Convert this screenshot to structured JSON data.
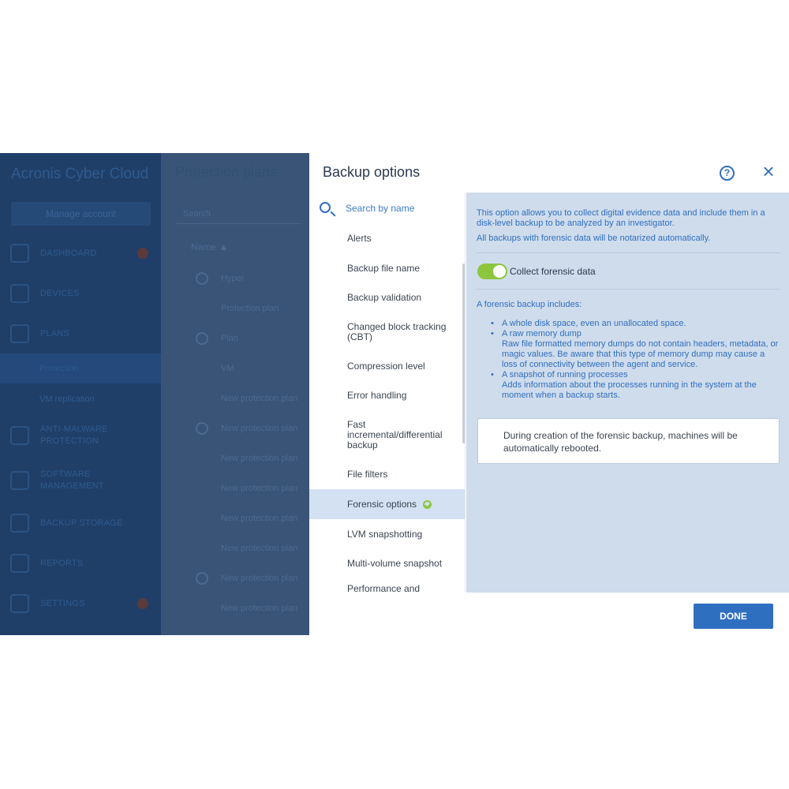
{
  "background_app": {
    "brand": "Acronis Cyber Cloud",
    "manage_account": "Manage account",
    "nav": [
      {
        "label": "DASHBOARD",
        "icon": "dashboard-icon"
      },
      {
        "label": "DEVICES",
        "icon": "monitor-icon"
      },
      {
        "label": "PLANS",
        "icon": "plans-icon"
      },
      {
        "label": "ANTI-MALWARE PROTECTION",
        "icon": "shield-icon"
      },
      {
        "label": "SOFTWARE MANAGEMENT",
        "icon": "software-icon"
      },
      {
        "label": "BACKUP STORAGE",
        "icon": "storage-icon"
      },
      {
        "label": "REPORTS",
        "icon": "reports-icon"
      },
      {
        "label": "SETTINGS",
        "icon": "gear-icon"
      }
    ],
    "nav_sub": [
      "Protection",
      "VM replication"
    ],
    "page_title": "Protection plans",
    "search_placeholder": "Search",
    "column_name": "Name",
    "plans": [
      "Hyper",
      "Protection plan",
      "Plan",
      "VM",
      "New protection plan",
      "New protection plan",
      "New protection plan",
      "New protection plan",
      "New protection plan",
      "New protection plan",
      "New protection plan",
      "New protection plan"
    ]
  },
  "dialog": {
    "title": "Backup options",
    "help_icon": "help-icon",
    "close_icon": "close-icon",
    "search": {
      "placeholder": "Search by name",
      "value": ""
    },
    "options": [
      "Alerts",
      "Backup file name",
      "Backup validation",
      "Changed block tracking (CBT)",
      "Compression level",
      "Error handling",
      "Fast incremental/differential backup",
      "File filters",
      "Forensic options",
      "LVM snapshotting",
      "Multi-volume snapshot",
      "Performance and backup"
    ],
    "selected_option": "Forensic options",
    "detail": {
      "intro": "This option allows you to collect digital evidence data and include them in a disk-level backup to be analyzed by an investigator.",
      "notarized": "All backups with forensic data will be notarized automatically.",
      "toggle_label": "Collect forensic data",
      "toggle_on": true,
      "includes_heading": "A forensic backup includes:",
      "bullets": [
        {
          "title": "A whole disk space, even an unallocated space.",
          "desc": ""
        },
        {
          "title": "A raw memory dump",
          "desc": "Raw file formatted memory dumps do not contain headers, metadata, or magic values. Be aware that this type of memory dump may cause a loss of connectivity between the agent and service."
        },
        {
          "title": "A snapshot of running processes",
          "desc": "Adds information about the processes running in the system at the moment when a backup starts."
        }
      ],
      "notice": "During creation of the forensic backup, machines will be automatically rebooted."
    },
    "done_label": "DONE"
  },
  "colors": {
    "accent": "#2f6fc0",
    "toggle_on": "#8cc63f",
    "detail_bg": "#cfdcec",
    "overlay_sidebar": "#1f3f69"
  }
}
